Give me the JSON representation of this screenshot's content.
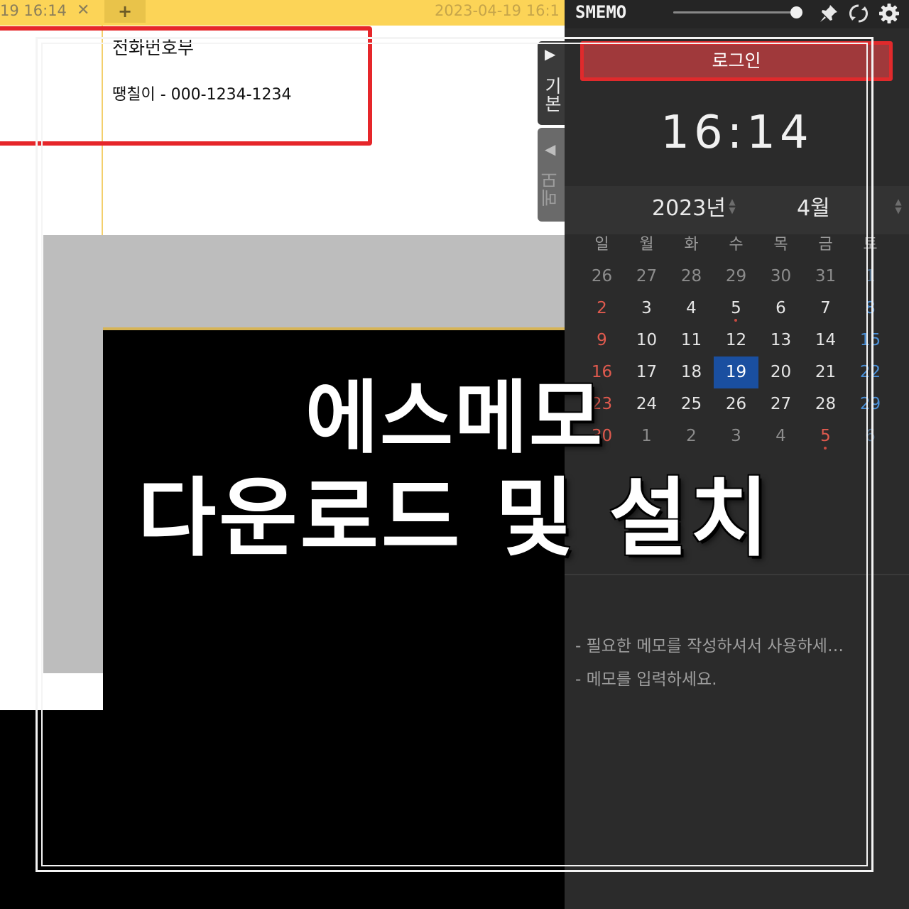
{
  "memo_window": {
    "tab_left_text": "19  16:14",
    "tab_close_glyph": "✕",
    "tab_add_glyph": "+",
    "tab_right_text": "2023-04-19  16:1",
    "memo_title": "전화번호부",
    "memo_line": "땡칠이 - 000-1234-1234"
  },
  "side_tabs": {
    "basic_arrow": "▶",
    "basic_label": "기본",
    "memo_arrow": "◀",
    "memo_label": "메모"
  },
  "app": {
    "logo": "SMEMO",
    "opacity_slider_value": 0.95,
    "icons": [
      "pin-icon",
      "refresh-icon",
      "gear-icon"
    ],
    "login_label": "로그인",
    "clock": "16:14",
    "year": "2023년",
    "month": "4월",
    "spin_up": "▲",
    "spin_down": "▼",
    "weekday_headers": [
      "일",
      "월",
      "화",
      "수",
      "목",
      "금",
      "토"
    ],
    "calendar_weeks": [
      [
        "26",
        "27",
        "28",
        "29",
        "30",
        "31",
        "1"
      ],
      [
        "2",
        "3",
        "4",
        "5",
        "6",
        "7",
        "8"
      ],
      [
        "9",
        "10",
        "11",
        "12",
        "13",
        "14",
        "15"
      ],
      [
        "16",
        "17",
        "18",
        "19",
        "20",
        "21",
        "22"
      ],
      [
        "23",
        "24",
        "25",
        "26",
        "27",
        "28",
        "29"
      ],
      [
        "30",
        "1",
        "2",
        "3",
        "4",
        "5",
        "6"
      ]
    ],
    "today": "19",
    "memo_items": [
      "- 필요한 메모를 작성하셔서 사용하세…",
      "- 메모를 입력하세요."
    ]
  },
  "overlay": {
    "title_line_1": "에스메모",
    "title_line_2": "다운로드 및 설치"
  },
  "colors": {
    "tab_yellow": "#fcd457",
    "alert_red": "#e6262a",
    "panel_dark": "#2b2b2b",
    "today_blue": "#1a4fa0",
    "sunday_red": "#e05a4e",
    "saturday_blue": "#4a8fd6"
  }
}
